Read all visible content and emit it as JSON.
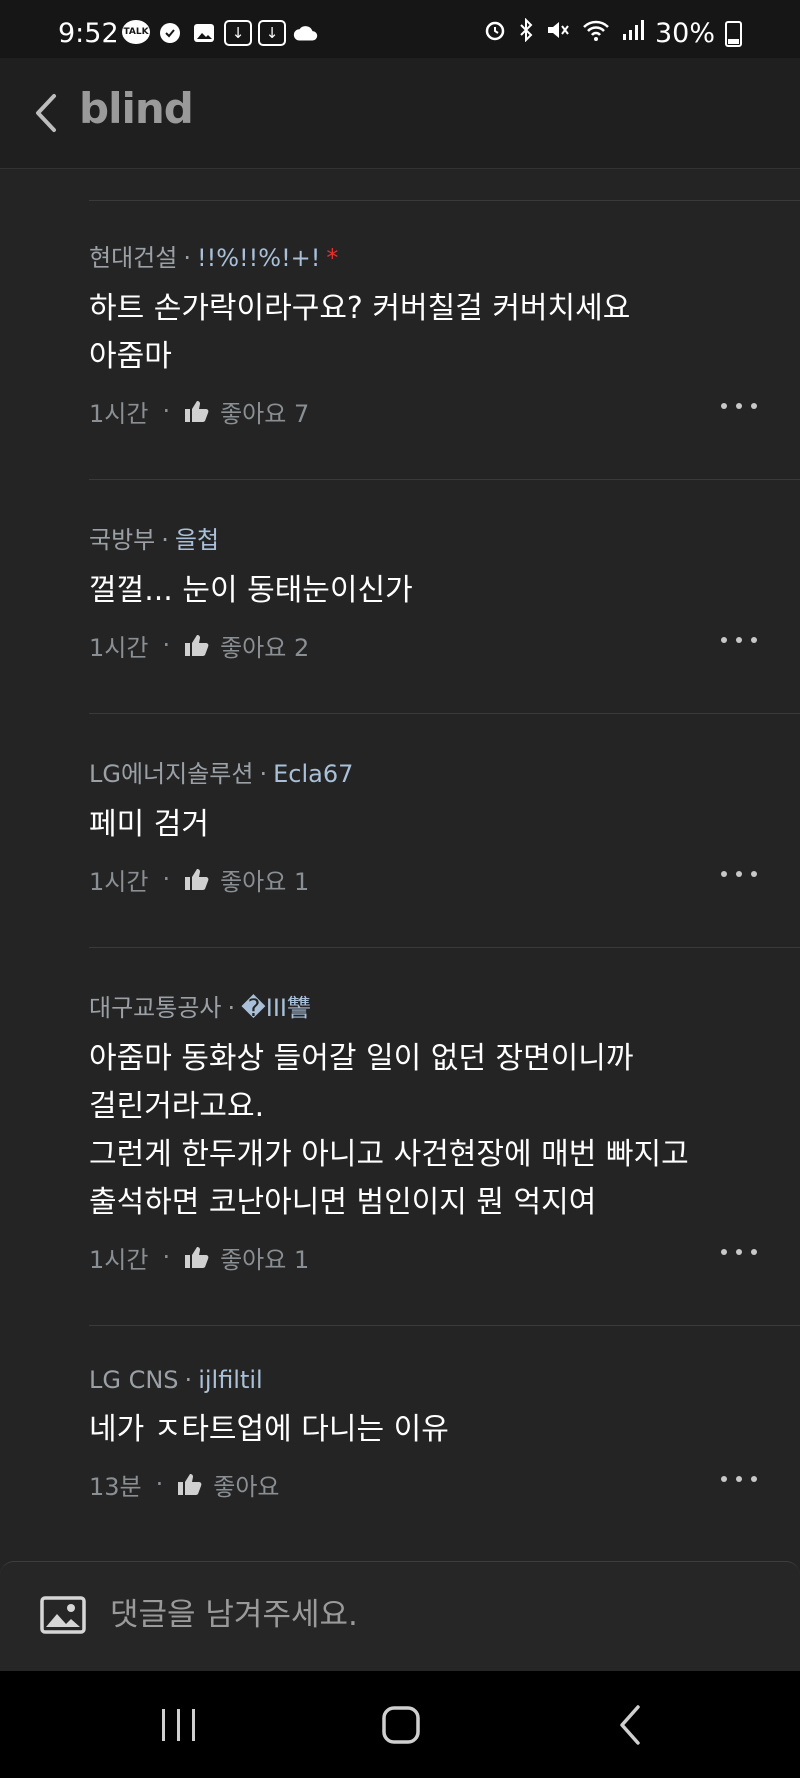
{
  "status_bar": {
    "time": "9:52",
    "left_icons": [
      "kakaotalk-icon",
      "messenger-icon",
      "gallery-icon",
      "download-icon",
      "download-icon",
      "cloud-icon"
    ],
    "right_icons": [
      "alarm-icon",
      "bluetooth-icon",
      "mute-icon",
      "wifi-icon",
      "signal-icon"
    ],
    "battery": "30%"
  },
  "header": {
    "brand": "blind"
  },
  "comments": [
    {
      "company": "현대건설",
      "user": "!!%!!%!+!",
      "author_mark": "*",
      "text": "하트 손가락이라구요? 커버칠걸 커버치세요\n아줌마",
      "time": "1시간",
      "likes": "좋아요 7"
    },
    {
      "company": "국방부",
      "user": "을첩",
      "text": "껄껄... 눈이 동태눈이신가",
      "time": "1시간",
      "likes": "좋아요 2"
    },
    {
      "company": "LG에너지솔루션",
      "user": "Ecla67",
      "text": "페미 검거",
      "time": "1시간",
      "likes": "좋아요 1"
    },
    {
      "company": "대구교통공사",
      "user": "�III讐",
      "text": "아줌마 동화상 들어갈 일이 없던 장면이니까\n걸린거라고요.\n그런게 한두개가 아니고 사건현장에 매번 빠지고\n출석하면 코난아니면 범인이지 뭔 억지여",
      "time": "1시간",
      "likes": "좋아요 1"
    },
    {
      "company": "LG CNS",
      "user": "ijlfiltil",
      "text": "네가 ㅈ타트업에 다니는 이유",
      "time": "13분",
      "likes": "좋아요"
    }
  ],
  "composer": {
    "placeholder": "댓글을 남겨주세요."
  },
  "nav": {
    "buttons": [
      "recent-apps",
      "home",
      "back"
    ]
  }
}
